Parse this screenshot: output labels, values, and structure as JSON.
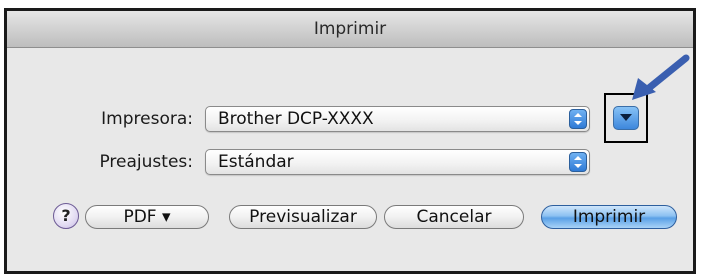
{
  "window": {
    "title": "Imprimir"
  },
  "printer": {
    "label": "Impresora:",
    "value": "Brother DCP-XXXX"
  },
  "presets": {
    "label": "Preajustes:",
    "value": "Estándar"
  },
  "buttons": {
    "help": "?",
    "pdf": "PDF ▾",
    "preview": "Previsualizar",
    "cancel": "Cancelar",
    "print": "Imprimir"
  },
  "icons": {
    "stepper": "up-down-stepper-icon",
    "disclosure": "disclosure-triangle-icon",
    "annotation": "callout-arrow-icon"
  },
  "colors": {
    "accent": "#3d87dc",
    "annotation_arrow": "#3a5fb0"
  }
}
